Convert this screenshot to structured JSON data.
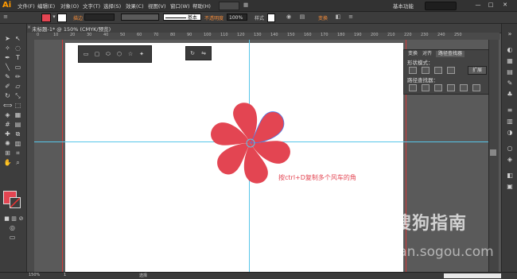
{
  "app": {
    "logo": "Ai",
    "menus": [
      "文件(F)",
      "编辑(E)",
      "对象(O)",
      "文字(T)",
      "选择(S)",
      "效果(C)",
      "视图(V)",
      "窗口(W)",
      "帮助(H)"
    ],
    "workspace": "基本功能",
    "window_buttons": [
      "—",
      "□",
      "✕"
    ]
  },
  "control_bar": {
    "fill_color": "#e34552",
    "stroke_label": "描边",
    "stroke_style": "基本",
    "opacity_label": "不透明度",
    "opacity_value": "100%",
    "style_label": "样式",
    "extra_label": "变换"
  },
  "document": {
    "tab_title": "未标题-1* @ 150% (CMYK/预览)",
    "close_glyph": "×"
  },
  "rulers": {
    "h_ticks": [
      "0",
      "10",
      "20",
      "30",
      "40",
      "50",
      "60",
      "70",
      "80",
      "90",
      "100",
      "110",
      "120",
      "130",
      "140",
      "150",
      "160",
      "170",
      "180",
      "190",
      "200",
      "210",
      "220",
      "230",
      "240",
      "250"
    ]
  },
  "panels": {
    "tabs": [
      "变换",
      "对齐",
      "路径查找器"
    ],
    "shape_modes_label": "形状模式：",
    "expand_label": "扩展",
    "pathfinder_label": "路径查找器："
  },
  "annotation": "按ctrl+D复制多个风车的角",
  "shape": {
    "color": "#e34552",
    "petal_count": 6
  },
  "status": {
    "zoom": "150%",
    "page": "1",
    "mode": "选择"
  },
  "watermark": {
    "main": "搜狗指南",
    "sub": "zhinan.sogou.com"
  }
}
